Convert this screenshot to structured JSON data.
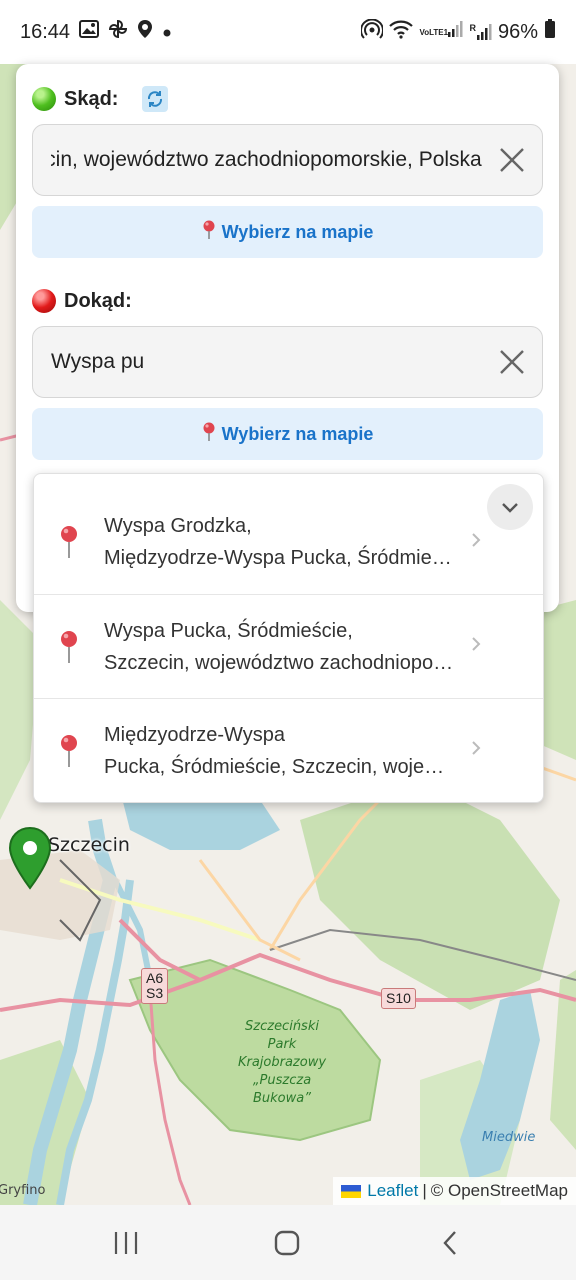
{
  "status_bar": {
    "time": "16:44",
    "battery": "96%",
    "icons": [
      "gallery-icon",
      "pinwheel-icon",
      "location-icon",
      "dot-icon",
      "hotspot-icon",
      "wifi-icon",
      "volte-icon",
      "signal-icon",
      "signal-r-icon",
      "battery-icon"
    ],
    "volte_label": "VoLTE1",
    "roaming_label": "R"
  },
  "route": {
    "from": {
      "label": "Skąd:",
      "value": "zczecin, województwo zachodniopomorskie, Polska",
      "pick_label": "Wybierz na mapie"
    },
    "to": {
      "label": "Dokąd:",
      "value": "Wyspa pu",
      "pick_label": "Wybierz na mapie"
    }
  },
  "suggestions": [
    {
      "line1": "Wyspa Grodzka,",
      "line2": "Międzyodrze-Wyspa Pucka, Śródmieście"
    },
    {
      "line1": "Wyspa Pucka, Śródmieście,",
      "line2": "Szczecin, województwo zachodniopomorskie"
    },
    {
      "line1": "Międzyodrze-Wyspa",
      "line2": "Pucka, Śródmieście, Szczecin, województwo"
    }
  ],
  "map": {
    "city": "Szczecin",
    "park": [
      "Szczeciński",
      "Park Krajobrazowy",
      "„Puszcza",
      "Bukowa”"
    ],
    "lake": "Miedwie",
    "town": "Gryfino",
    "shield_a6": "A6",
    "shield_s3": "S3",
    "shield_s10": "S10",
    "attribution": {
      "leaflet": "Leaflet",
      "separator": "|",
      "osm": "© OpenStreetMap"
    }
  },
  "colors": {
    "accent": "#1a73c9",
    "pick_bg": "#e3f0fc",
    "pin_green": "#2e9e2e",
    "pin_red": "#e0454f"
  }
}
